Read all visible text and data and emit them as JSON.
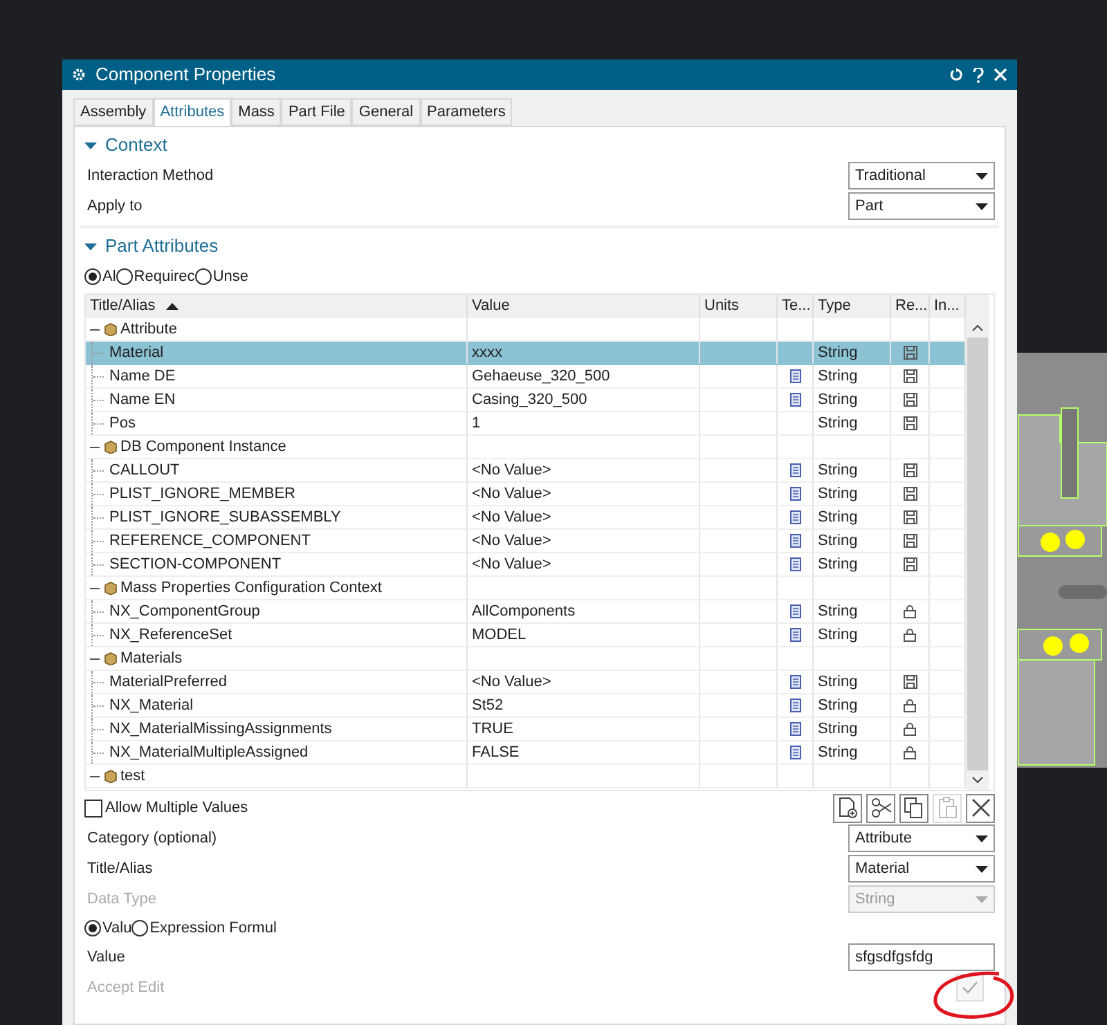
{
  "window": {
    "title": "Component Properties"
  },
  "tabs": [
    {
      "label": "Assembly",
      "selected": false
    },
    {
      "label": "Attributes",
      "selected": true
    },
    {
      "label": "Mass",
      "selected": false
    },
    {
      "label": "Part File",
      "selected": false
    },
    {
      "label": "General",
      "selected": false
    },
    {
      "label": "Parameters",
      "selected": false
    }
  ],
  "context": {
    "title": "Context",
    "expanded": true,
    "fields": [
      {
        "label": "Interaction Method",
        "value": "Traditional"
      },
      {
        "label": "Apply to",
        "value": "Part"
      }
    ]
  },
  "part_attributes": {
    "title": "Part Attributes",
    "expanded": true,
    "filters": [
      {
        "label": "Al",
        "selected": true
      },
      {
        "label": "Requirec",
        "selected": false
      },
      {
        "label": "Unse",
        "selected": false
      }
    ],
    "table": {
      "columns": [
        {
          "label": "Title/Alias",
          "sorted": true
        },
        {
          "label": "Value",
          "sorted": false
        },
        {
          "label": "Units",
          "sorted": false
        },
        {
          "label": "Te...",
          "sorted": false
        },
        {
          "label": "Type",
          "sorted": false
        },
        {
          "label": "Re...",
          "sorted": false
        },
        {
          "label": "In...",
          "sorted": false
        }
      ],
      "groups": [
        {
          "name": "Attribute",
          "expanded": true,
          "children": [
            {
              "title": "Material",
              "value": "xxxx",
              "note": false,
              "type": "String",
              "kind": "save",
              "selected": true
            },
            {
              "title": "Name DE",
              "value": "Gehaeuse_320_500",
              "note": true,
              "type": "String",
              "kind": "save",
              "selected": false
            },
            {
              "title": "Name EN",
              "value": "Casing_320_500",
              "note": true,
              "type": "String",
              "kind": "save",
              "selected": false
            },
            {
              "title": "Pos",
              "value": "1",
              "note": false,
              "type": "String",
              "kind": "save",
              "selected": false
            }
          ]
        },
        {
          "name": "DB Component Instance",
          "expanded": true,
          "children": [
            {
              "title": "CALLOUT",
              "value": "<No Value>",
              "note": true,
              "type": "String",
              "kind": "save",
              "selected": false
            },
            {
              "title": "PLIST_IGNORE_MEMBER",
              "value": "<No Value>",
              "note": true,
              "type": "String",
              "kind": "save",
              "selected": false
            },
            {
              "title": "PLIST_IGNORE_SUBASSEMBLY",
              "value": "<No Value>",
              "note": true,
              "type": "String",
              "kind": "save",
              "selected": false
            },
            {
              "title": "REFERENCE_COMPONENT",
              "value": "<No Value>",
              "note": true,
              "type": "String",
              "kind": "save",
              "selected": false
            },
            {
              "title": "SECTION-COMPONENT",
              "value": "<No Value>",
              "note": true,
              "type": "String",
              "kind": "save",
              "selected": false
            }
          ]
        },
        {
          "name": "Mass Properties Configuration Context",
          "expanded": true,
          "children": [
            {
              "title": "NX_ComponentGroup",
              "value": "AllComponents",
              "note": true,
              "type": "String",
              "kind": "lock",
              "selected": false
            },
            {
              "title": "NX_ReferenceSet",
              "value": "MODEL",
              "note": true,
              "type": "String",
              "kind": "lock",
              "selected": false
            }
          ]
        },
        {
          "name": "Materials",
          "expanded": true,
          "children": [
            {
              "title": "MaterialPreferred",
              "value": "<No Value>",
              "note": true,
              "type": "String",
              "kind": "save",
              "selected": false
            },
            {
              "title": "NX_Material",
              "value": "St52",
              "note": true,
              "type": "String",
              "kind": "lock",
              "selected": false
            },
            {
              "title": "NX_MaterialMissingAssignments",
              "value": "TRUE",
              "note": true,
              "type": "String",
              "kind": "lock",
              "selected": false
            },
            {
              "title": "NX_MaterialMultipleAssigned",
              "value": "FALSE",
              "note": true,
              "type": "String",
              "kind": "lock",
              "selected": false
            }
          ]
        },
        {
          "name": "test",
          "expanded": true
        }
      ]
    }
  },
  "allow_multiple": {
    "label": "Allow Multiple Values",
    "checked": false
  },
  "tools": [
    {
      "kind": "new",
      "disabled": false
    },
    {
      "kind": "cut",
      "disabled": false
    },
    {
      "kind": "copy",
      "disabled": false
    },
    {
      "kind": "paste",
      "disabled": true
    },
    {
      "kind": "delete",
      "disabled": false
    }
  ],
  "fields": [
    {
      "label": "Category (optional)",
      "value": "Attribute",
      "disabled": false
    },
    {
      "label": "Title/Alias",
      "value": "Material",
      "disabled": false
    },
    {
      "label": "Data Type",
      "value": "String",
      "disabled": true
    }
  ],
  "value_modes": [
    {
      "label": "Valu",
      "selected": true
    },
    {
      "label": "Expression Formul",
      "selected": false
    }
  ],
  "value": {
    "label": "Value",
    "value": "sfgsdfgsfdg"
  },
  "accept": {
    "label": "Accept Edit",
    "disabled": true
  }
}
